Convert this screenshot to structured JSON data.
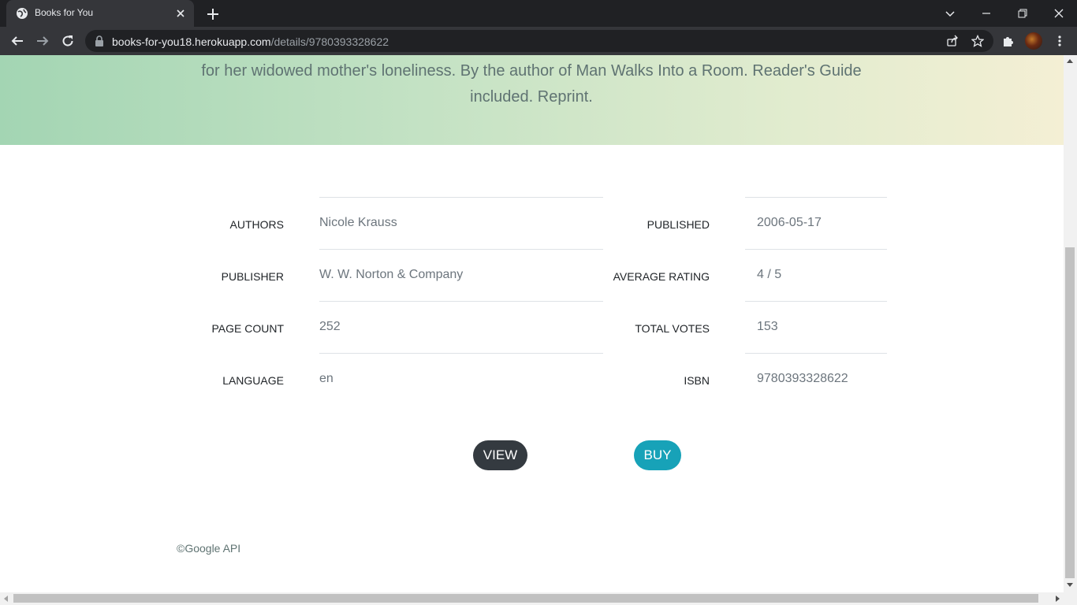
{
  "browser": {
    "tab_title": "Books for You",
    "url_host": "books-for-you18.herokuapp.com",
    "url_path": "/details/9780393328622"
  },
  "hero": {
    "description_tail": "for her widowed mother's loneliness. By the author of Man Walks Into a Room. Reader's Guide included. Reprint."
  },
  "details": {
    "authors_label": "AUTHORS",
    "authors_value": "Nicole Krauss",
    "publisher_label": "PUBLISHER",
    "publisher_value": "W. W. Norton & Company",
    "page_count_label": "PAGE COUNT",
    "page_count_value": "252",
    "language_label": "LANGUAGE",
    "language_value": "en",
    "published_label": "PUBLISHED",
    "published_value": "2006-05-17",
    "avg_rating_label": "AVERAGE RATING",
    "avg_rating_value": "4 / 5",
    "total_votes_label": "TOTAL VOTES",
    "total_votes_value": "153",
    "isbn_label": "ISBN",
    "isbn_value": "9780393328622"
  },
  "actions": {
    "view_label": "VIEW",
    "buy_label": "BUY"
  },
  "footer": {
    "text": "©Google API"
  },
  "colors": {
    "view_button": "#343a40",
    "buy_button": "#17a2b8"
  }
}
